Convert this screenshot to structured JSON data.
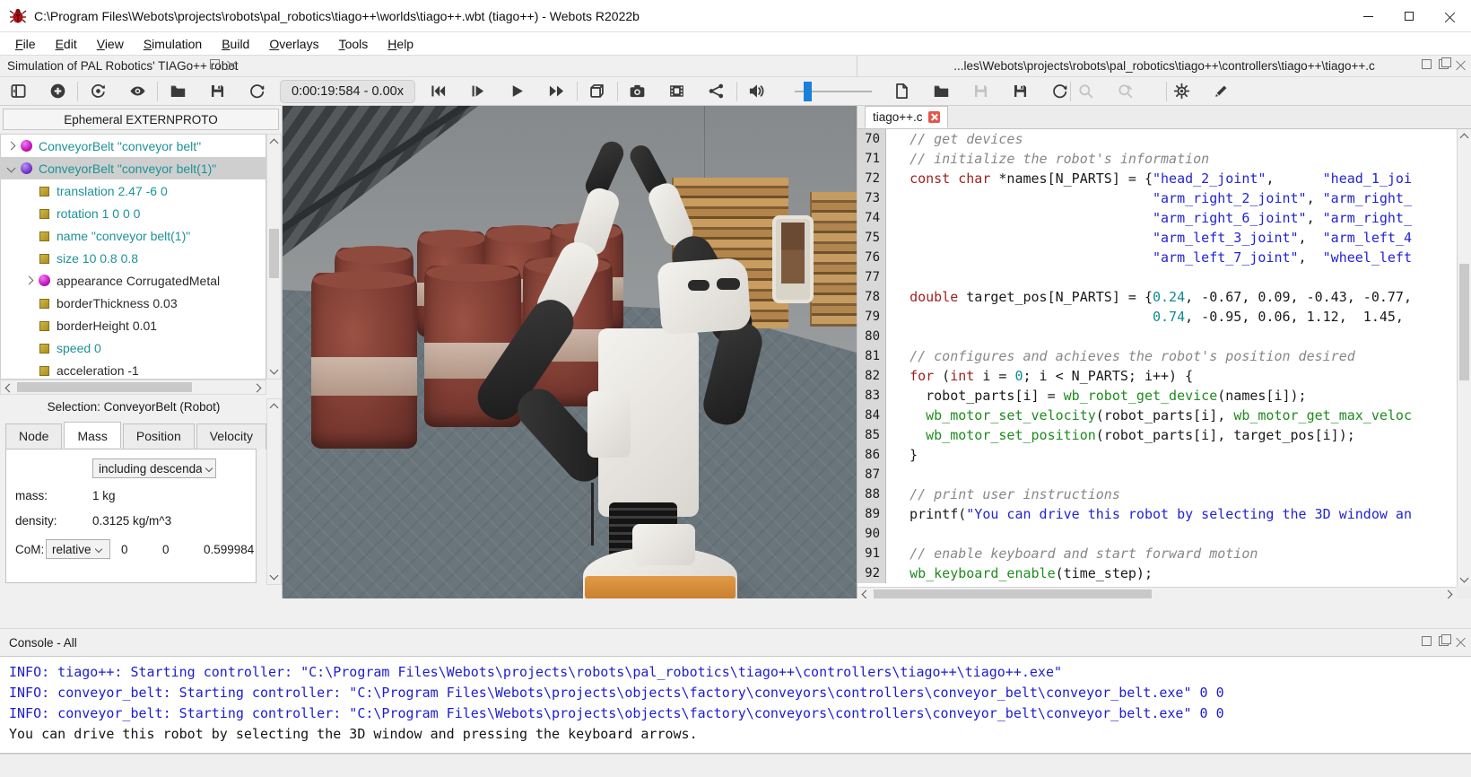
{
  "window": {
    "title": "C:\\Program Files\\Webots\\projects\\robots\\pal_robotics\\tiago++\\worlds\\tiago++.wbt (tiago++) - Webots R2022b",
    "controls": [
      "minimize",
      "maximize",
      "close"
    ]
  },
  "menu": {
    "items": [
      "File",
      "Edit",
      "View",
      "Simulation",
      "Build",
      "Overlays",
      "Tools",
      "Help"
    ]
  },
  "left_dock": {
    "header": "Simulation of PAL Robotics' TIAGo++ robot",
    "header_icons": [
      "float-window-icon",
      "close-icon"
    ]
  },
  "toolbar": {
    "time_display": "0:00:19:584  -  0.00x",
    "icons": [
      "panel-toggle-icon",
      "add-node-icon",
      "reset-viewpoint-icon",
      "eye-icon",
      "open-world-icon",
      "save-world-icon",
      "reload-world-icon",
      "rewind-icon",
      "step-icon",
      "play-icon",
      "fast-forward-icon",
      "cube-icon",
      "snapshot-icon",
      "movie-icon",
      "share-icon",
      "sound-icon"
    ],
    "volume_slider": {
      "value_hint": "low"
    }
  },
  "right_dock": {
    "header": "...les\\Webots\\projects\\robots\\pal_robotics\\tiago++\\controllers\\tiago++\\tiago++.c",
    "header_icons": [
      "float-window-icon",
      "restore-window-icon",
      "close-icon"
    ],
    "toolbar_icons": [
      "new-file-icon",
      "open-file-icon",
      "save-file-icon",
      "save-as-icon",
      "revert-file-icon",
      "find-icon",
      "find-replace-icon",
      "preferences-gear-icon",
      "highlight-pencil-icon"
    ]
  },
  "scene_tree": {
    "header": "Ephemeral EXTERNPROTO",
    "items": [
      {
        "expand": "right",
        "icon": "sphere-magenta",
        "indent": 0,
        "label": "ConveyorBelt \"conveyor belt\"",
        "color": "teal",
        "selected": false
      },
      {
        "expand": "down",
        "icon": "sphere-purple",
        "indent": 0,
        "label": "ConveyorBelt \"conveyor belt(1)\"",
        "color": "teal",
        "selected": true
      },
      {
        "expand": "none",
        "icon": "field",
        "indent": 1,
        "label": "translation 2.47 -6 0",
        "color": "teal",
        "selected": false
      },
      {
        "expand": "none",
        "icon": "field",
        "indent": 1,
        "label": "rotation 1 0 0 0",
        "color": "teal",
        "selected": false
      },
      {
        "expand": "none",
        "icon": "field",
        "indent": 1,
        "label": "name \"conveyor belt(1)\"",
        "color": "teal",
        "selected": false
      },
      {
        "expand": "none",
        "icon": "field",
        "indent": 1,
        "label": "size 10 0.8 0.8",
        "color": "teal",
        "selected": false
      },
      {
        "expand": "right",
        "icon": "sphere-magenta",
        "indent": 1,
        "label": "appearance CorrugatedMetal",
        "color": "black",
        "selected": false
      },
      {
        "expand": "none",
        "icon": "field",
        "indent": 1,
        "label": "borderThickness 0.03",
        "color": "black",
        "selected": false
      },
      {
        "expand": "none",
        "icon": "field",
        "indent": 1,
        "label": "borderHeight 0.01",
        "color": "black",
        "selected": false
      },
      {
        "expand": "none",
        "icon": "field",
        "indent": 1,
        "label": "speed 0",
        "color": "teal",
        "selected": false
      },
      {
        "expand": "none",
        "icon": "field",
        "indent": 1,
        "label": "acceleration -1",
        "color": "black",
        "selected": false
      }
    ]
  },
  "inspector": {
    "header": "Selection: ConveyorBelt (Robot)",
    "tabs": [
      {
        "label": "Node"
      },
      {
        "label": "Mass",
        "active": true
      },
      {
        "label": "Position"
      },
      {
        "label": "Velocity"
      }
    ],
    "mass": {
      "mode_dropdown": "including descenda",
      "mass_label": "mass:",
      "mass_value": "1 kg",
      "density_label": "density:",
      "density_value": "0.3125 kg/m^3",
      "com_label": "CoM:",
      "com_mode": "relative",
      "com": [
        "0",
        "0",
        "0.599984"
      ]
    }
  },
  "editor": {
    "tab": "tiago++.c",
    "lines": [
      {
        "n": "70",
        "s": [
          [
            "pl",
            "  "
          ],
          [
            "cm",
            "// get devices"
          ]
        ]
      },
      {
        "n": "71",
        "s": [
          [
            "pl",
            "  "
          ],
          [
            "cm",
            "// initialize the robot's information"
          ]
        ]
      },
      {
        "n": "72",
        "s": [
          [
            "pl",
            "  "
          ],
          [
            "kw",
            "const"
          ],
          [
            "pl",
            " "
          ],
          [
            "kw",
            "char"
          ],
          [
            "pl",
            " *names[N_PARTS] = {"
          ],
          [
            "str",
            "\"head_2_joint\""
          ],
          [
            "pl",
            ",      "
          ],
          [
            "str",
            "\"head_1_joi"
          ]
        ]
      },
      {
        "n": "73",
        "s": [
          [
            "pl",
            "                                "
          ],
          [
            "str",
            "\"arm_right_2_joint\""
          ],
          [
            "pl",
            ", "
          ],
          [
            "str",
            "\"arm_right_"
          ]
        ]
      },
      {
        "n": "74",
        "s": [
          [
            "pl",
            "                                "
          ],
          [
            "str",
            "\"arm_right_6_joint\""
          ],
          [
            "pl",
            ", "
          ],
          [
            "str",
            "\"arm_right_"
          ]
        ]
      },
      {
        "n": "75",
        "s": [
          [
            "pl",
            "                                "
          ],
          [
            "str",
            "\"arm_left_3_joint\""
          ],
          [
            "pl",
            ",  "
          ],
          [
            "str",
            "\"arm_left_4"
          ]
        ]
      },
      {
        "n": "76",
        "s": [
          [
            "pl",
            "                                "
          ],
          [
            "str",
            "\"arm_left_7_joint\""
          ],
          [
            "pl",
            ",  "
          ],
          [
            "str",
            "\"wheel_left"
          ]
        ]
      },
      {
        "n": "77",
        "s": []
      },
      {
        "n": "78",
        "s": [
          [
            "pl",
            "  "
          ],
          [
            "kw",
            "double"
          ],
          [
            "pl",
            " target_pos[N_PARTS] = {"
          ],
          [
            "num",
            "0.24"
          ],
          [
            "pl",
            ", -0.67, 0.09, -0.43, -0.77,"
          ]
        ]
      },
      {
        "n": "79",
        "s": [
          [
            "pl",
            "                                "
          ],
          [
            "num",
            "0.74"
          ],
          [
            "pl",
            ", -0.95, 0.06, 1.12,  1.45,"
          ]
        ]
      },
      {
        "n": "80",
        "s": []
      },
      {
        "n": "81",
        "s": [
          [
            "pl",
            "  "
          ],
          [
            "cm",
            "// configures and achieves the robot's position desired"
          ]
        ]
      },
      {
        "n": "82",
        "s": [
          [
            "pl",
            "  "
          ],
          [
            "kw",
            "for"
          ],
          [
            "pl",
            " ("
          ],
          [
            "kw",
            "int"
          ],
          [
            "pl",
            " i = "
          ],
          [
            "num",
            "0"
          ],
          [
            "pl",
            "; i < N_PARTS; i++) {"
          ]
        ]
      },
      {
        "n": "83",
        "s": [
          [
            "pl",
            "    robot_parts[i] = "
          ],
          [
            "fn",
            "wb_robot_get_device"
          ],
          [
            "pl",
            "(names[i]);"
          ]
        ]
      },
      {
        "n": "84",
        "s": [
          [
            "pl",
            "    "
          ],
          [
            "fn",
            "wb_motor_set_velocity"
          ],
          [
            "pl",
            "(robot_parts[i], "
          ],
          [
            "fn",
            "wb_motor_get_max_veloc"
          ]
        ]
      },
      {
        "n": "85",
        "s": [
          [
            "pl",
            "    "
          ],
          [
            "fn",
            "wb_motor_set_position"
          ],
          [
            "pl",
            "(robot_parts[i], target_pos[i]);"
          ]
        ]
      },
      {
        "n": "86",
        "s": [
          [
            "pl",
            "  }"
          ]
        ]
      },
      {
        "n": "87",
        "s": []
      },
      {
        "n": "88",
        "s": [
          [
            "pl",
            "  "
          ],
          [
            "cm",
            "// print user instructions"
          ]
        ]
      },
      {
        "n": "89",
        "s": [
          [
            "pl",
            "  printf("
          ],
          [
            "str",
            "\"You can drive this robot by selecting the 3D window an"
          ]
        ]
      },
      {
        "n": "90",
        "s": []
      },
      {
        "n": "91",
        "s": [
          [
            "pl",
            "  "
          ],
          [
            "cm",
            "// enable keyboard and start forward motion"
          ]
        ]
      },
      {
        "n": "92",
        "s": [
          [
            "pl",
            "  "
          ],
          [
            "fn",
            "wb_keyboard_enable"
          ],
          [
            "pl",
            "(time_step);"
          ]
        ]
      }
    ]
  },
  "console": {
    "header": "Console - All",
    "header_icons": [
      "float-window-icon",
      "restore-window-icon",
      "close-icon"
    ],
    "lines": [
      {
        "cls": "info",
        "text": "INFO: tiago++: Starting controller: \"C:\\Program Files\\Webots\\projects\\robots\\pal_robotics\\tiago++\\controllers\\tiago++\\tiago++.exe\""
      },
      {
        "cls": "info",
        "text": "INFO: conveyor_belt: Starting controller: \"C:\\Program Files\\Webots\\projects\\objects\\factory\\conveyors\\controllers\\conveyor_belt\\conveyor_belt.exe\" 0 0"
      },
      {
        "cls": "info",
        "text": "INFO: conveyor_belt: Starting controller: \"C:\\Program Files\\Webots\\projects\\objects\\factory\\conveyors\\controllers\\conveyor_belt\\conveyor_belt.exe\" 0 0"
      },
      {
        "cls": "plain",
        "text": "You can drive this robot by selecting the 3D window and pressing the keyboard arrows."
      }
    ]
  },
  "colors": {
    "accent_blue": "#1a80d8",
    "tree_modified_teal": "#1d9296",
    "keyword_red": "#9e1f1c",
    "string_blue": "#2323d2",
    "number_teal": "#0c8c8c",
    "api_green": "#1f8b1f",
    "console_info_blue": "#1d1dd0",
    "tab_close_red": "#e2574c",
    "base_orange": "#d8923f"
  }
}
